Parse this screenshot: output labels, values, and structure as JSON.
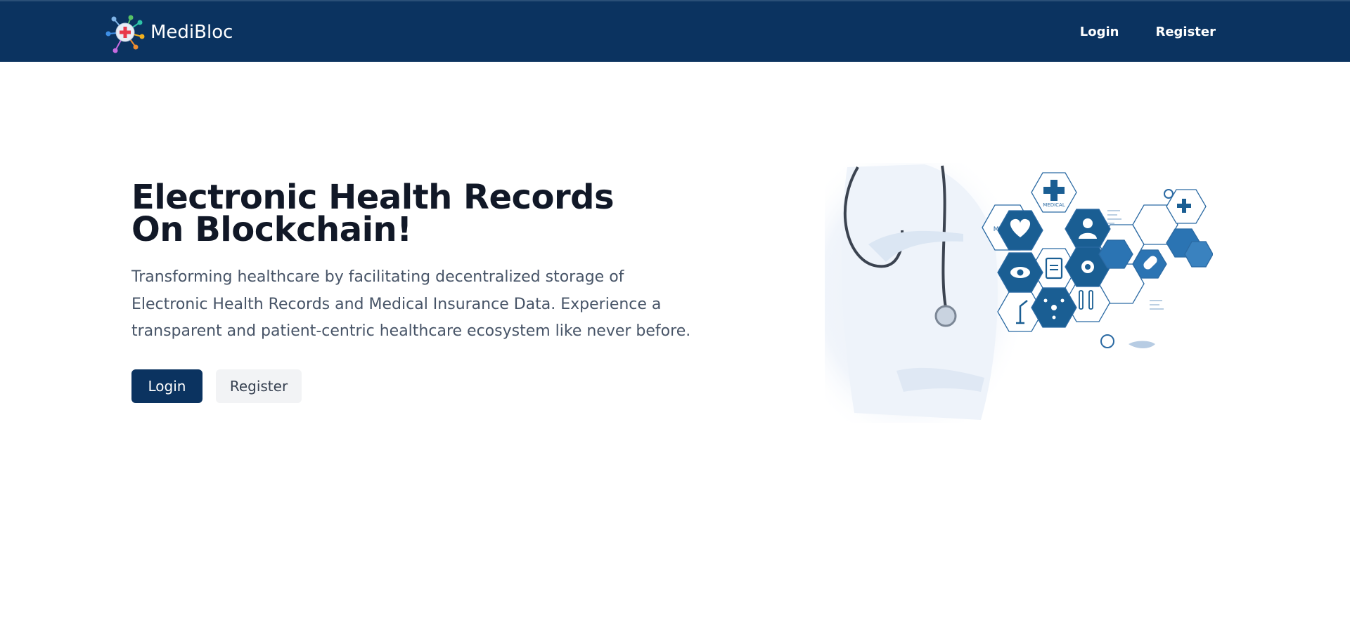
{
  "navbar": {
    "brand_name": "MediBloc",
    "logo_icon": "medical-network-cross-icon",
    "links": [
      {
        "label": "Login"
      },
      {
        "label": "Register"
      }
    ]
  },
  "hero": {
    "title_line1": "Electronic Health Records",
    "title_line2": "On Blockchain!",
    "description": "Transforming healthcare by facilitating decentralized storage of Electronic Health Records and Medical Insurance Data. Experience a transparent and patient-centric healthcare ecosystem like never before.",
    "buttons": {
      "login": "Login",
      "register": "Register"
    },
    "image_labels": {
      "hex_medical_left": "MEDICAL",
      "hex_medical_top": "MEDICAL"
    }
  },
  "colors": {
    "navbar_bg": "#0b3360",
    "primary": "#0b3360",
    "secondary_bg": "#f2f3f5",
    "text_dark": "#111827",
    "text_muted": "#475467",
    "hex_blue": "#1a5e93"
  }
}
